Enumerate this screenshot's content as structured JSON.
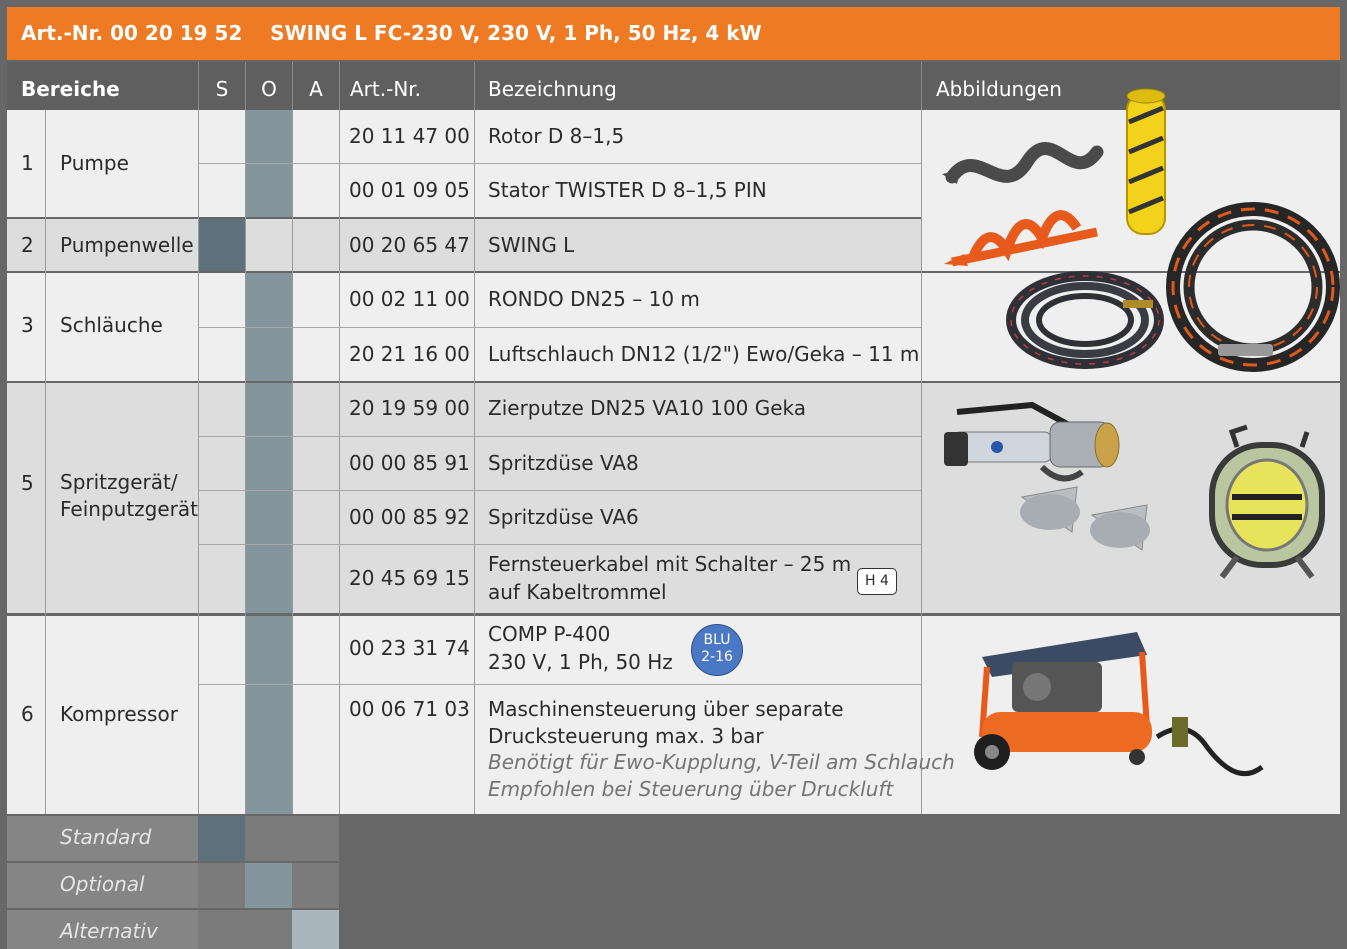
{
  "title": "Art.-Nr. 00 20 19 52    SWING L FC-230 V, 230 V, 1 Ph, 50 Hz, 4 kW",
  "headers": {
    "bereiche": "Bereiche",
    "s": "S",
    "o": "O",
    "a": "A",
    "artnr": "Art.-Nr.",
    "bezeichnung": "Bezeichnung",
    "abbildungen": "Abbildungen"
  },
  "groups": [
    {
      "num": "1",
      "name": "Pumpe",
      "shading": "light"
    },
    {
      "num": "2",
      "name": "Pumpenwelle",
      "shading": "dark"
    },
    {
      "num": "3",
      "name": "Schläuche",
      "shading": "light"
    },
    {
      "num": "5",
      "name": "Spritzgerät/\nFeinputzgerät",
      "shading": "dark"
    },
    {
      "num": "6",
      "name": "Kompressor",
      "shading": "light"
    }
  ],
  "rows": [
    {
      "group": "1",
      "art": "20 11 47 00",
      "desc": "Rotor D 8–1,5",
      "sel": "O"
    },
    {
      "group": "1",
      "art": "00 01 09 05",
      "desc": "Stator TWISTER D 8–1,5 PIN",
      "sel": "O"
    },
    {
      "group": "2",
      "art": "00 20 65 47",
      "desc": "SWING L",
      "sel": "S"
    },
    {
      "group": "3",
      "art": "00 02 11 00",
      "desc": "RONDO DN25 – 10 m",
      "sel": "O"
    },
    {
      "group": "3",
      "art": "20 21 16 00",
      "desc": "Luftschlauch DN12 (1/2\") Ewo/Geka – 11 m",
      "sel": "O"
    },
    {
      "group": "5",
      "art": "20 19 59 00",
      "desc": "Zierputze DN25 VA10 100 Geka",
      "sel": "O"
    },
    {
      "group": "5",
      "art": "00 00 85 91",
      "desc": "Spritzdüse VA8",
      "sel": "O"
    },
    {
      "group": "5",
      "art": "00 00 85 92",
      "desc": "Spritzdüse VA6",
      "sel": "O"
    },
    {
      "group": "5",
      "art": "20 45 69 15",
      "desc_line1": "Fernsteuerkabel mit Schalter – 25 m",
      "desc_line2": "auf Kabeltrommel",
      "badge": "H 4",
      "sel": "O"
    },
    {
      "group": "6",
      "art": "00 23 31 74",
      "desc_line1": "COMP P-400",
      "desc_line2": "230 V, 1 Ph, 50 Hz",
      "badge_line1": "BLU",
      "badge_line2": "2-16",
      "sel": "O"
    },
    {
      "group": "6",
      "art": "00 06 71 03",
      "desc_line1": "Maschinensteuerung über separate",
      "desc_line2": "Drucksteuerung max. 3 bar",
      "note_line1": "Benötigt für Ewo-Kupplung, V-Teil am Schlauch",
      "note_line2": "Empfohlen bei Steuerung über Druckluft",
      "sel": "O"
    }
  ],
  "legend": {
    "standard": "Standard",
    "optional": "Optional",
    "alternativ": "Alternativ"
  },
  "colors": {
    "accent": "#ee7a23",
    "header": "#5f5f5f",
    "standard": "#5e7079",
    "optional": "#85959e",
    "alternativ": "#a9b6bd",
    "background": "#676767"
  },
  "illustrations": [
    "rotor-and-stator-image",
    "hoses-image",
    "spray-gun-and-cable-reel-image",
    "compressor-image"
  ]
}
